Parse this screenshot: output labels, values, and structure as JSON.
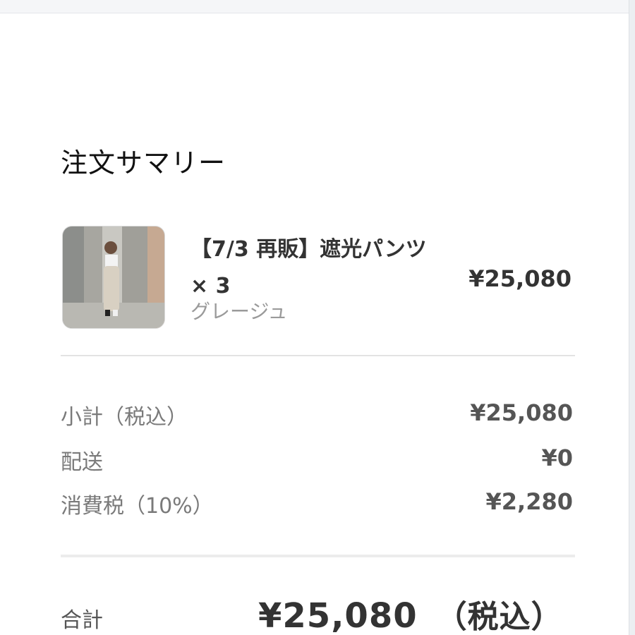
{
  "summary": {
    "title": "注文サマリー"
  },
  "item": {
    "name": "【7/3 再販】遮光パンツ × 3",
    "variant": "グレージュ",
    "price": "¥25,080",
    "thumbnail_icon": "product-photo"
  },
  "breakdown": [
    {
      "label": "小計（税込）",
      "value": "¥25,080"
    },
    {
      "label": "配送",
      "value": "¥0"
    },
    {
      "label": "消費税（10%）",
      "value": "¥2,280"
    }
  ],
  "total": {
    "label": "合計",
    "value": "¥25,080",
    "suffix": "（税込）"
  }
}
